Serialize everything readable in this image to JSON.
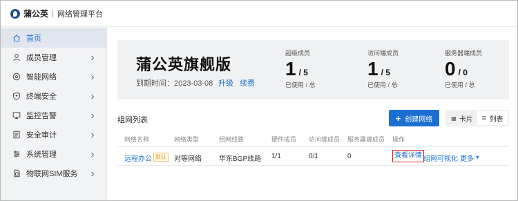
{
  "brand": {
    "name": "蒲公英",
    "subtitle": "网络管理平台"
  },
  "sidebar": {
    "items": [
      {
        "label": "首页",
        "icon": "home-icon",
        "active": true
      },
      {
        "label": "成员管理",
        "icon": "user-icon"
      },
      {
        "label": "智能网络",
        "icon": "network-icon"
      },
      {
        "label": "终端安全",
        "icon": "shield-icon"
      },
      {
        "label": "监控告警",
        "icon": "monitor-icon"
      },
      {
        "label": "安全审计",
        "icon": "audit-icon"
      },
      {
        "label": "系统管理",
        "icon": "settings-icon"
      },
      {
        "label": "物联网SIM服务",
        "icon": "sim-icon"
      }
    ]
  },
  "plan": {
    "title": "蒲公英旗舰版",
    "expiry": "到期时间：2023-03-08",
    "upgrade": "升级",
    "renew": "续费"
  },
  "stats": [
    {
      "label": "超级成员",
      "used": "1",
      "total": "/ 5",
      "sub": "已使用 / 总"
    },
    {
      "label": "访问端成员",
      "used": "1",
      "total": "/ 5",
      "sub": "已使用 / 总"
    },
    {
      "label": "服务器端成员",
      "used": "0",
      "total": "/ 0",
      "sub": "已使用 / 总"
    }
  ],
  "list": {
    "title": "组网列表",
    "create_button": "创建网络",
    "view_card": "卡片",
    "view_list": "列表",
    "columns": [
      "网络名称",
      "网络类型",
      "组网线路",
      "硬件成员",
      "访问端成员",
      "服务器端成员",
      "操作"
    ],
    "rows": [
      {
        "name": "远程办公",
        "badge": "默认",
        "type": "对等网络",
        "line": "华东BGP线路",
        "hardware": "1/1",
        "access": "0/1",
        "server": "0",
        "actions": {
          "detail": "查看详情",
          "visualize": "组网可视化",
          "more": "更多"
        }
      }
    ]
  },
  "colors": {
    "accent": "#1a6fd1",
    "sidebar_bg": "#f2f3f5",
    "banner_bg": "#f0f1f3",
    "badge": "#e49a1c",
    "highlight_border": "#dd2222"
  }
}
